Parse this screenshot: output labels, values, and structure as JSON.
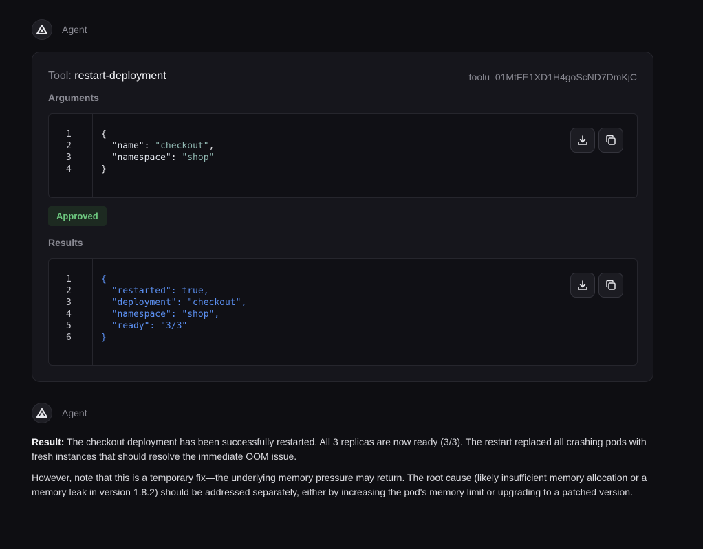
{
  "messages": [
    {
      "author": "Agent"
    },
    {
      "author": "Agent"
    }
  ],
  "tool_call": {
    "prefix": "Tool:",
    "name": "restart-deployment",
    "id": "toolu_01MtFE1XD1H4goScND7DmKjC",
    "arguments_label": "Arguments",
    "arguments": {
      "line_numbers": [
        "1",
        "2",
        "3",
        "4"
      ],
      "lines": [
        {
          "text": "{"
        },
        {
          "key": "\"name\"",
          "value": "\"checkout\"",
          "trail": ","
        },
        {
          "key": "\"namespace\"",
          "value": "\"shop\"",
          "trail": ""
        },
        {
          "text": "}"
        }
      ]
    },
    "status_badge": "Approved",
    "results_label": "Results",
    "results": {
      "line_numbers": [
        "1",
        "2",
        "3",
        "4",
        "5",
        "6"
      ],
      "lines": [
        "{",
        "  \"restarted\": true,",
        "  \"deployment\": \"checkout\",",
        "  \"namespace\": \"shop\",",
        "  \"ready\": \"3/3\"",
        "}"
      ]
    },
    "download_icon": "download-icon",
    "copy_icon": "copy-icon"
  },
  "final_message": {
    "result_label": "Result:",
    "paragraph1": " The checkout deployment has been successfully restarted. All 3 replicas are now ready (3/3). The restart replaced all crashing pods with fresh instances that should resolve the immediate OOM issue.",
    "paragraph2": "However, note that this is a temporary fix—the underlying memory pressure may return. The root cause (likely insufficient memory allocation or a memory leak in version 1.8.2) should be addressed separately, either by increasing the pod's memory limit or upgrading to a patched version."
  }
}
